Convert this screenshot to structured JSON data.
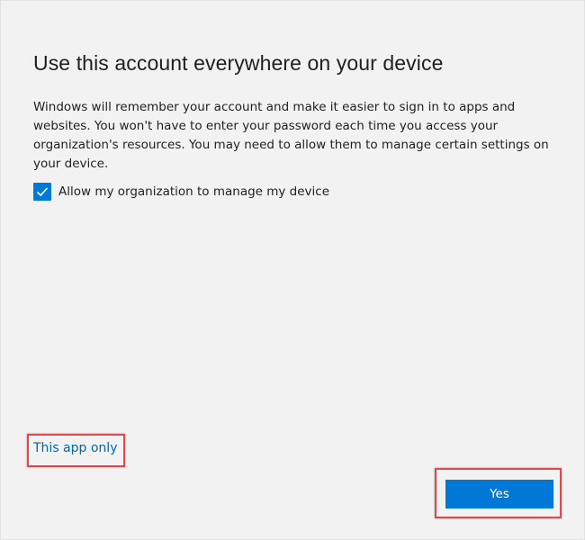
{
  "dialog": {
    "title": "Use this account everywhere on your device",
    "description": "Windows will remember your account and make it easier to sign in to apps and websites. You won't have to enter your password each time you access your organization's resources. You may need to allow them to manage certain settings on your device.",
    "checkbox": {
      "label": "Allow my organization to manage my device",
      "checked": true,
      "icon": "checkmark-icon"
    },
    "link_label": "This app only",
    "yes_label": "Yes"
  },
  "colors": {
    "background": "#f2f2f2",
    "accent": "#0078d7",
    "link": "#0067b8",
    "highlight": "#e0474c"
  }
}
